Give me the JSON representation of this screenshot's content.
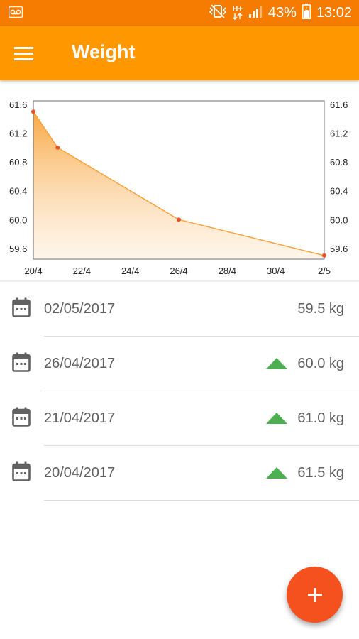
{
  "status_bar": {
    "battery": "43%",
    "time": "13:02",
    "network": "H+",
    "icons": [
      "voicemail-icon",
      "vibrate-icon",
      "network-icon",
      "signal-icon",
      "battery-icon"
    ]
  },
  "app_bar": {
    "title": "Weight",
    "menu_icon": "hamburger-menu-icon"
  },
  "colors": {
    "status_bar": "#f57c00",
    "app_bar": "#ff9800",
    "line": "#f7a23a",
    "point": "#e8532b",
    "up_arrow": "#4caf50",
    "fab": "#f4511e"
  },
  "chart_data": {
    "type": "area",
    "x_ticks": [
      "20/4",
      "22/4",
      "24/4",
      "26/4",
      "28/4",
      "30/4",
      "2/5"
    ],
    "y_ticks": [
      "59.6",
      "60.0",
      "60.4",
      "60.8",
      "61.2",
      "61.6"
    ],
    "ylim": [
      59.45,
      61.65
    ],
    "series": [
      {
        "points": [
          {
            "x": "20/04/2017",
            "y": 61.5
          },
          {
            "x": "21/04/2017",
            "y": 61.0
          },
          {
            "x": "26/04/2017",
            "y": 60.0
          },
          {
            "x": "02/05/2017",
            "y": 59.5
          }
        ]
      }
    ],
    "grid": false,
    "axes_labels_both_sides": true
  },
  "entries": [
    {
      "date": "02/05/2017",
      "weight": "59.5 kg",
      "trend": "none"
    },
    {
      "date": "26/04/2017",
      "weight": "60.0 kg",
      "trend": "up"
    },
    {
      "date": "21/04/2017",
      "weight": "61.0 kg",
      "trend": "up"
    },
    {
      "date": "20/04/2017",
      "weight": "61.5 kg",
      "trend": "up"
    }
  ],
  "fab": {
    "label": "+",
    "icon": "add-icon"
  }
}
